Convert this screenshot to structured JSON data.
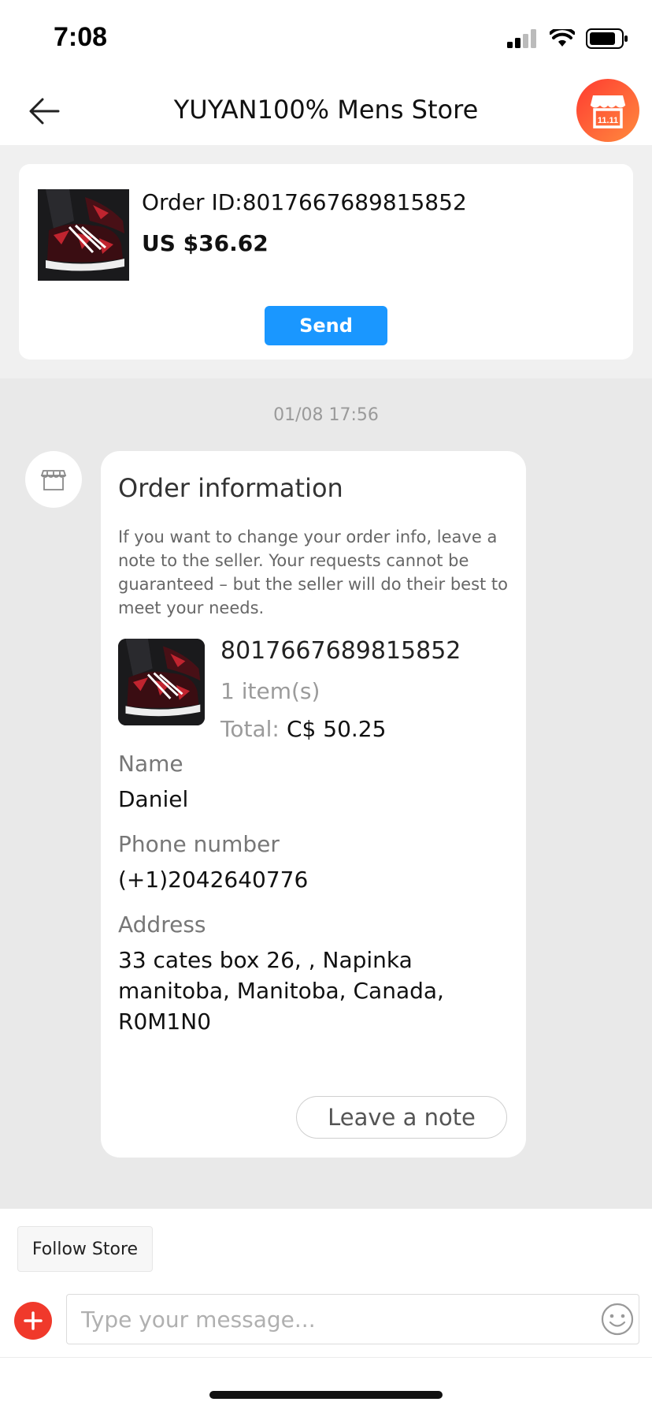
{
  "status_bar": {
    "time": "7:08"
  },
  "header": {
    "title": "YUYAN100% Mens Store"
  },
  "product_card": {
    "order_id_line": "Order ID:8017667689815852",
    "price": "US $36.62",
    "send_label": "Send"
  },
  "chat": {
    "timestamp": "01/08 17:56",
    "order_info": {
      "title": "Order information",
      "description": "If you want to change your order info, leave a note to the seller. Your requests cannot be guaranteed – but the seller will do their best to meet your needs.",
      "order_number": "8017667689815852",
      "item_count": "1 item(s)",
      "total_label": "Total:",
      "total_value": "C$ 50.25",
      "name_label": "Name",
      "name_value": "Daniel",
      "phone_label": "Phone number",
      "phone_value": "(+1)2042640776",
      "address_label": "Address",
      "address_value": "33 cates box 26, , Napinka manitoba, Manitoba, Canada, R0M1N0",
      "leave_note_label": "Leave a note"
    }
  },
  "bottom": {
    "follow_store_label": "Follow Store",
    "message_placeholder": "Type your message..."
  },
  "colors": {
    "accent_blue": "#1a97ff",
    "store_red": "#ff3b30",
    "plus_red": "#f0392b"
  },
  "icons": [
    "back-arrow-icon",
    "store-icon",
    "signal-icon",
    "wifi-icon",
    "battery-icon",
    "plus-icon",
    "emoji-icon"
  ]
}
